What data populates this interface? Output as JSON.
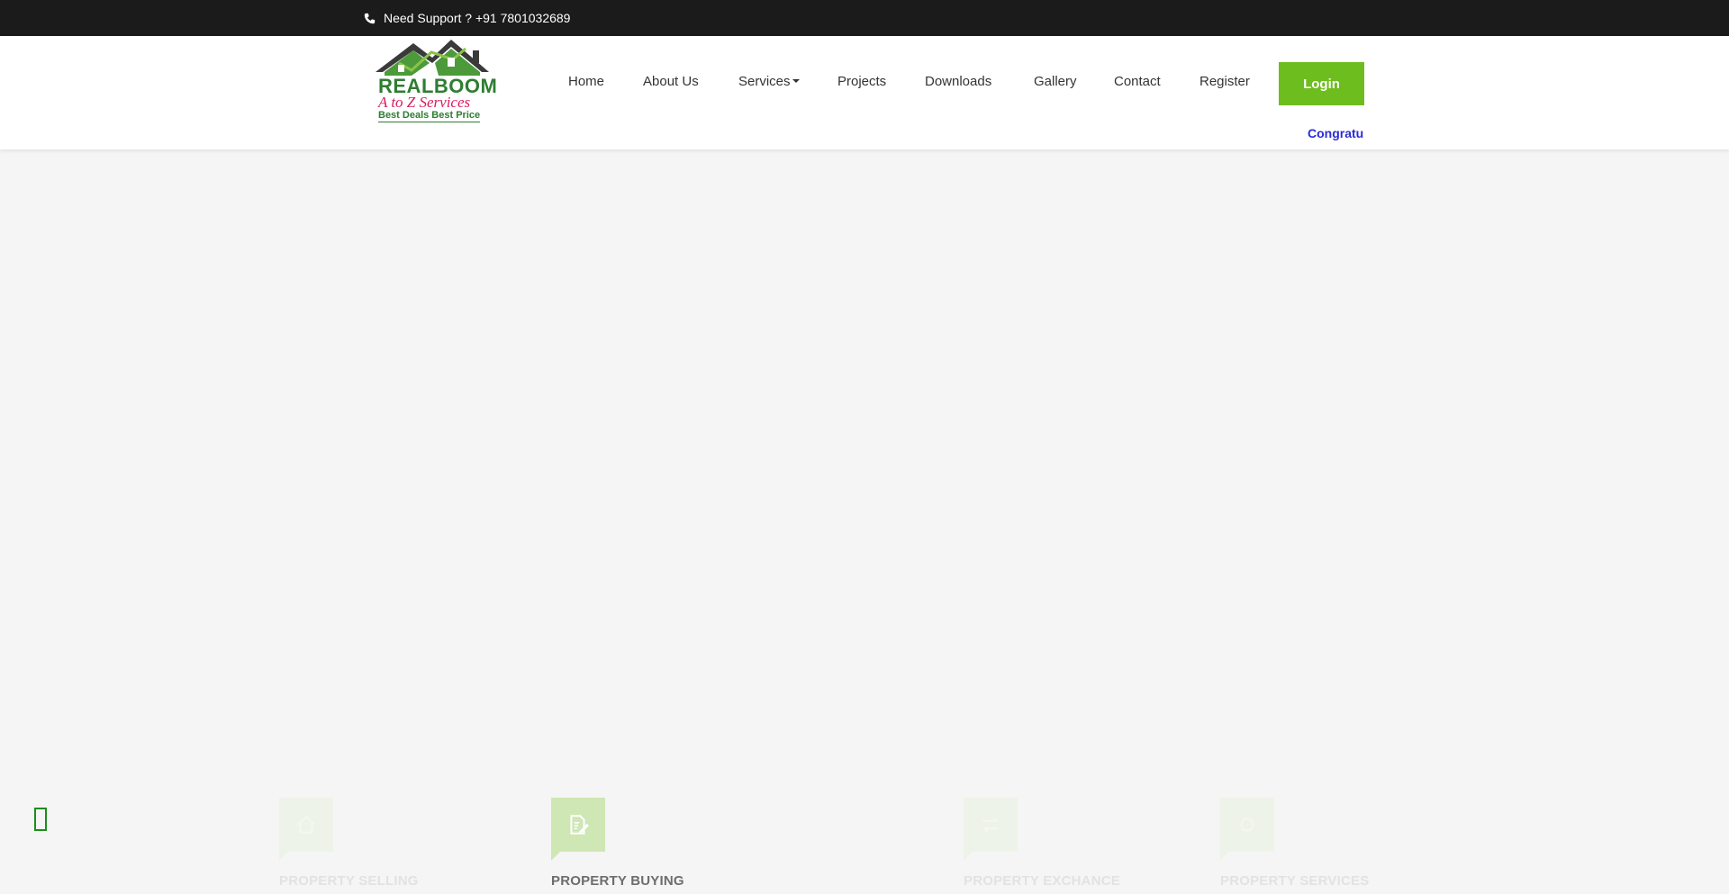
{
  "topbar": {
    "support_text": "Need Support ? +91 7801032689",
    "icon": "phone-icon"
  },
  "logo": {
    "brand": "REALBOOM",
    "tagline": "A to Z Services",
    "slogan": "Best Deals Best Price"
  },
  "nav": {
    "items": [
      {
        "label": "Home"
      },
      {
        "label": "About Us"
      },
      {
        "label": "Services"
      },
      {
        "label": "Projects"
      },
      {
        "label": "Downloads"
      },
      {
        "label": "Gallery"
      },
      {
        "label": "Contact"
      },
      {
        "label": "Register"
      }
    ],
    "login_label": "Login"
  },
  "ticker_text": "Congratu",
  "services": [
    {
      "title": "PROPERTY SELLING",
      "icon": "house-icon"
    },
    {
      "title": "PROPERTY BUYING",
      "icon": "document-edit-icon"
    },
    {
      "title": "PROPERTY EXCHANCE",
      "icon": "exchange-icon"
    },
    {
      "title": "PROPERTY SERVICES",
      "icon": "tools-icon"
    }
  ],
  "colors": {
    "topbar_bg": "#1b1b1b",
    "accent_green": "#6dbd1e",
    "ticker_blue": "#2b2bd6",
    "page_bg": "#f5f5f5"
  }
}
